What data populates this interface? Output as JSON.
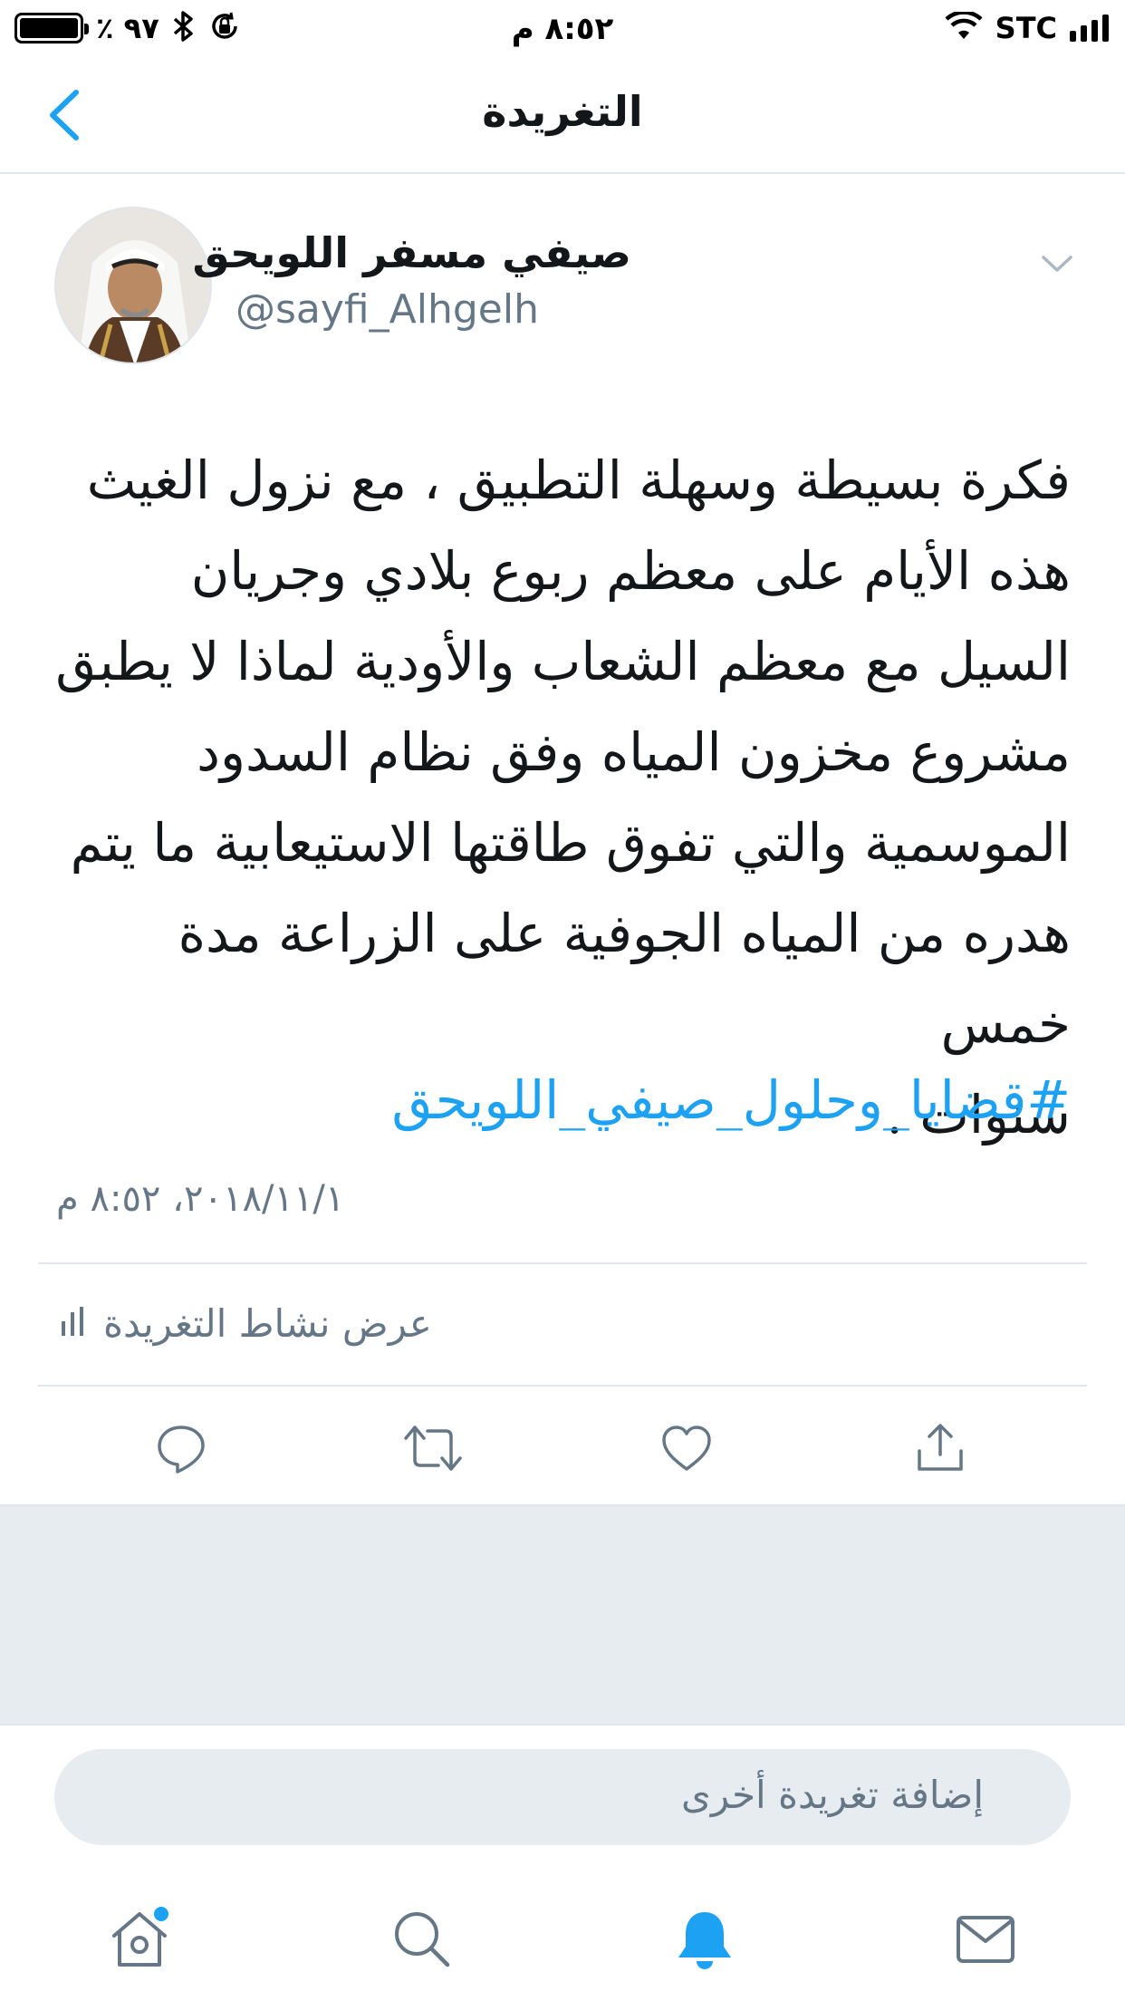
{
  "status_bar": {
    "battery_percent": "٪ ٩٧",
    "time": "٨:٥٢ م",
    "carrier": "STC"
  },
  "nav": {
    "title": "التغريدة",
    "back_icon": "chevron-left-icon"
  },
  "tweet": {
    "author_name": "صيفي مسفر اللويحق",
    "author_handle": "@sayfi_Alhgelh",
    "text_lines": [
      "فكرة بسيطة وسهلة التطبيق ، مع نزول الغيث",
      "هذه الأيام على معظم ربوع بلادي وجريان",
      "السيل مع معظم الشعاب والأودية لماذا لا يطبق",
      "مشروع مخزون المياه وفق نظام السدود",
      "الموسمية والتي تفوق طاقتها الاستيعابية ما يتم",
      "هدره من المياه الجوفية على الزراعة مدة خمس",
      "سنوات ."
    ],
    "hashtag": "#قضايا_وحلول_صيفي_اللويحق",
    "timestamp": "٢٠١٨/١١/١، ٨:٥٢ م",
    "activity_label": "عرض نشاط التغريدة"
  },
  "actions": {
    "icons": [
      "reply-icon",
      "retweet-icon",
      "like-icon",
      "share-icon"
    ]
  },
  "reply": {
    "placeholder": "إضافة تغريدة أخرى"
  },
  "tabbar": {
    "tabs": [
      "home-icon",
      "search-icon",
      "notifications-icon",
      "messages-icon"
    ],
    "active_tab": "notifications-icon"
  },
  "colors": {
    "accent": "#1da1f2",
    "secondary_text": "#657786",
    "divider": "#e1e8ed",
    "background_gray": "#e6ecf0"
  }
}
